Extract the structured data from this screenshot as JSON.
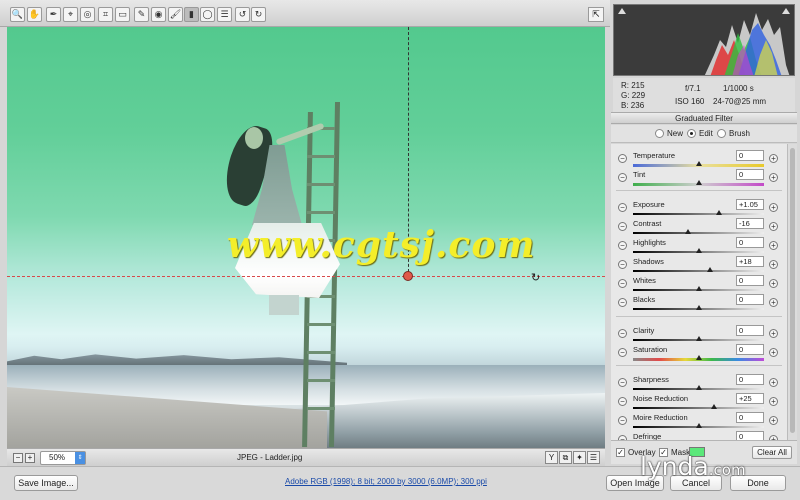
{
  "toolbar": {
    "tools": [
      {
        "name": "zoom-tool",
        "glyph": "🔍"
      },
      {
        "name": "hand-tool",
        "glyph": "✋"
      },
      {
        "name": "white-balance-tool",
        "glyph": "✒"
      },
      {
        "name": "color-sampler-tool",
        "glyph": "⌖"
      },
      {
        "name": "targeted-adjustment-tool",
        "glyph": "◎"
      },
      {
        "name": "crop-tool",
        "glyph": "⌗"
      },
      {
        "name": "straighten-tool",
        "glyph": "▭"
      },
      {
        "name": "spot-removal-tool",
        "glyph": "✎"
      },
      {
        "name": "red-eye-tool",
        "glyph": "◉"
      },
      {
        "name": "adjustment-brush-tool",
        "glyph": "🖌"
      },
      {
        "name": "graduated-filter-tool",
        "glyph": "▮",
        "active": true
      },
      {
        "name": "radial-filter-tool",
        "glyph": "◯"
      },
      {
        "name": "open-preferences-tool",
        "glyph": "☰"
      },
      {
        "name": "rotate-ccw-tool",
        "glyph": "↺"
      },
      {
        "name": "rotate-cw-tool",
        "glyph": "↻"
      }
    ],
    "fullscreen_glyph": "⇱"
  },
  "canvas": {
    "watermark": "www.cgtsj.com"
  },
  "statusbar": {
    "zoom_out": "−",
    "zoom_in": "+",
    "zoom_value": "50%",
    "file_label": "JPEG  -  Ladder.jpg",
    "view_buttons": [
      "Y",
      "⧉",
      "✦",
      "☰"
    ]
  },
  "bottombar": {
    "save_label": "Save Image...",
    "workflow_text": "Adobe RGB (1998); 8 bit; 2000 by 3000 (6.0MP); 300 ppi",
    "open_label": "Open Image",
    "cancel_label": "Cancel",
    "done_label": "Done"
  },
  "brand": {
    "name": "lynda",
    "suffix": ".com"
  },
  "readout": {
    "r": "R:",
    "r_val": "215",
    "g": "G:",
    "g_val": "229",
    "b": "B:",
    "b_val": "236",
    "aperture": "f/7.1",
    "shutter": "1/1000 s",
    "iso": "ISO 160",
    "lens": "24-70@25 mm"
  },
  "panel": {
    "title": "Graduated Filter",
    "modes": [
      "New",
      "Edit",
      "Brush"
    ],
    "selected_mode": "Edit"
  },
  "sliders": [
    {
      "label": "Temperature",
      "value": "0",
      "pos": 0.5,
      "track": "temp"
    },
    {
      "label": "Tint",
      "value": "0",
      "pos": 0.5,
      "track": "tint"
    },
    {
      "label": "Exposure",
      "value": "+1.05",
      "pos": 0.66,
      "track": "dark"
    },
    {
      "label": "Contrast",
      "value": "-16",
      "pos": 0.42,
      "track": "dark"
    },
    {
      "label": "Highlights",
      "value": "0",
      "pos": 0.5,
      "track": "dark"
    },
    {
      "label": "Shadows",
      "value": "+18",
      "pos": 0.59,
      "track": "dark"
    },
    {
      "label": "Whites",
      "value": "0",
      "pos": 0.5,
      "track": "dark"
    },
    {
      "label": "Blacks",
      "value": "0",
      "pos": 0.5,
      "track": "dark"
    },
    {
      "label": "Clarity",
      "value": "0",
      "pos": 0.5,
      "track": "dark"
    },
    {
      "label": "Saturation",
      "value": "0",
      "pos": 0.5,
      "track": "sat"
    },
    {
      "label": "Sharpness",
      "value": "0",
      "pos": 0.5,
      "track": "dark"
    },
    {
      "label": "Noise Reduction",
      "value": "+25",
      "pos": 0.62,
      "track": "dark"
    },
    {
      "label": "Moire Reduction",
      "value": "0",
      "pos": 0.5,
      "track": "dark"
    },
    {
      "label": "Defringe",
      "value": "0",
      "pos": 0.5,
      "track": "dark"
    }
  ],
  "panel_bottom": {
    "overlay_label": "Overlay",
    "mask_label": "Mask",
    "mask_color": "#5be87a",
    "clear_label": "Clear All",
    "check_glyph": "✓"
  },
  "colors": {
    "accent": "#4a90e2",
    "pin": "#e05a4a",
    "watermark": "#f4ee2a"
  }
}
